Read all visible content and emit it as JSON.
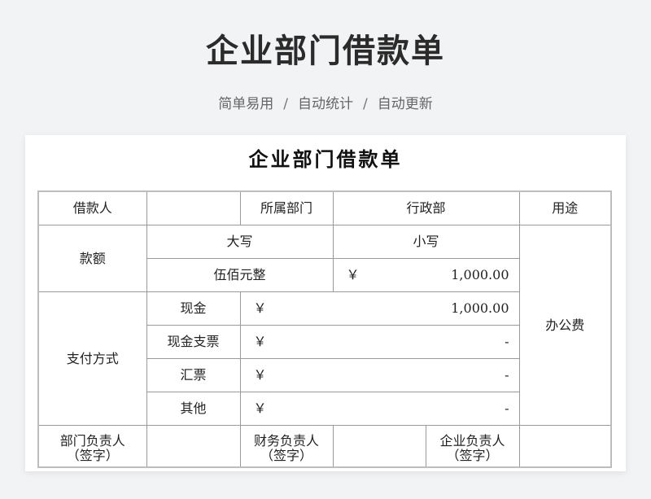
{
  "banner": {
    "title": "企业部门借款单",
    "tags": [
      "简单易用",
      "自动统计",
      "自动更新"
    ],
    "separator": "/"
  },
  "form": {
    "title": "企业部门借款单",
    "borrower_label": "借款人",
    "borrower_value": "",
    "department_label": "所属部门",
    "department_value": "行政部",
    "purpose_label": "用途",
    "purpose_value": "办公费",
    "amount_label": "款额",
    "uppercase_label": "大写",
    "lowercase_label": "小写",
    "uppercase_value": "伍佰元整",
    "currency_symbol": "￥",
    "lowercase_value": "1,000.00",
    "payment_label": "支付方式",
    "payment_methods": [
      {
        "label": "现金",
        "amount": "1,000.00"
      },
      {
        "label": "现金支票",
        "amount": "-"
      },
      {
        "label": "汇票",
        "amount": "-"
      },
      {
        "label": "其他",
        "amount": "-"
      }
    ],
    "signatures": [
      {
        "label": "部门负责人",
        "note": "（签字）"
      },
      {
        "label": "财务负责人",
        "note": "（签字）"
      },
      {
        "label": "企业负责人",
        "note": "（签字）"
      }
    ]
  }
}
